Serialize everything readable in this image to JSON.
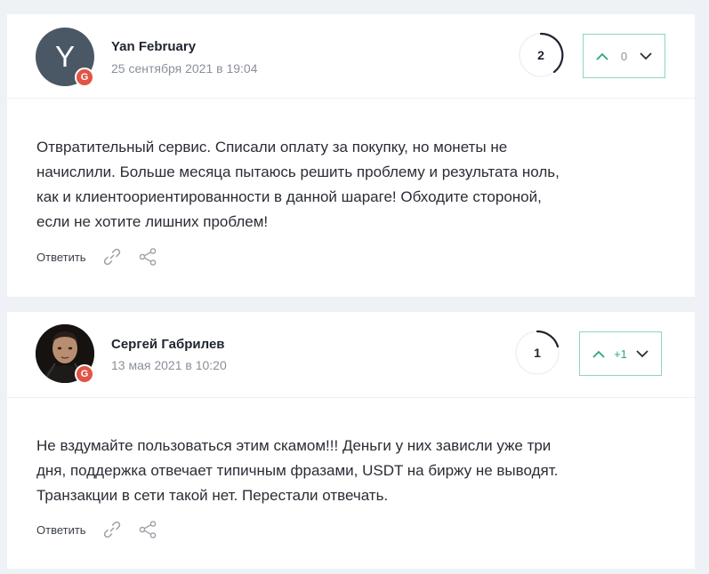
{
  "comments": [
    {
      "author": "Yan February",
      "avatar_letter": "Y",
      "badge": "G",
      "date": "25 сентября 2021 в 19:04",
      "rating": "2",
      "votes": "0",
      "text": "Отвратительный сервис. Списали оплату за покупку, но монеты не\nначислили. Больше месяца пытаюсь решить проблему и результата ноль,\nкак и клиентоориентированности в данной шараге! Обходите стороной,\nесли не хотите лишних проблем!",
      "reply_label": "Ответить"
    },
    {
      "author": "Сергей Габрилев",
      "badge": "G",
      "date": "13 мая 2021 в 10:20",
      "rating": "1",
      "votes": "+1",
      "text": "Не вздумайте пользоваться этим скамом!!! Деньги у них зависли уже три\nдня, поддержка отвечает типичным фразами, USDT на биржу не выводят.\nТранзакции в сети такой нет. Перестали отвечать.",
      "reply_label": "Ответить"
    }
  ],
  "colors": {
    "accent": "#2aa77f",
    "vote_border": "#8fd3c2",
    "badge": "#e05545",
    "avatar_bg": "#4a5764"
  },
  "icons": {
    "vote_up": "chevron-up-icon",
    "vote_down": "chevron-down-icon",
    "link": "link-icon",
    "share": "share-icon"
  }
}
